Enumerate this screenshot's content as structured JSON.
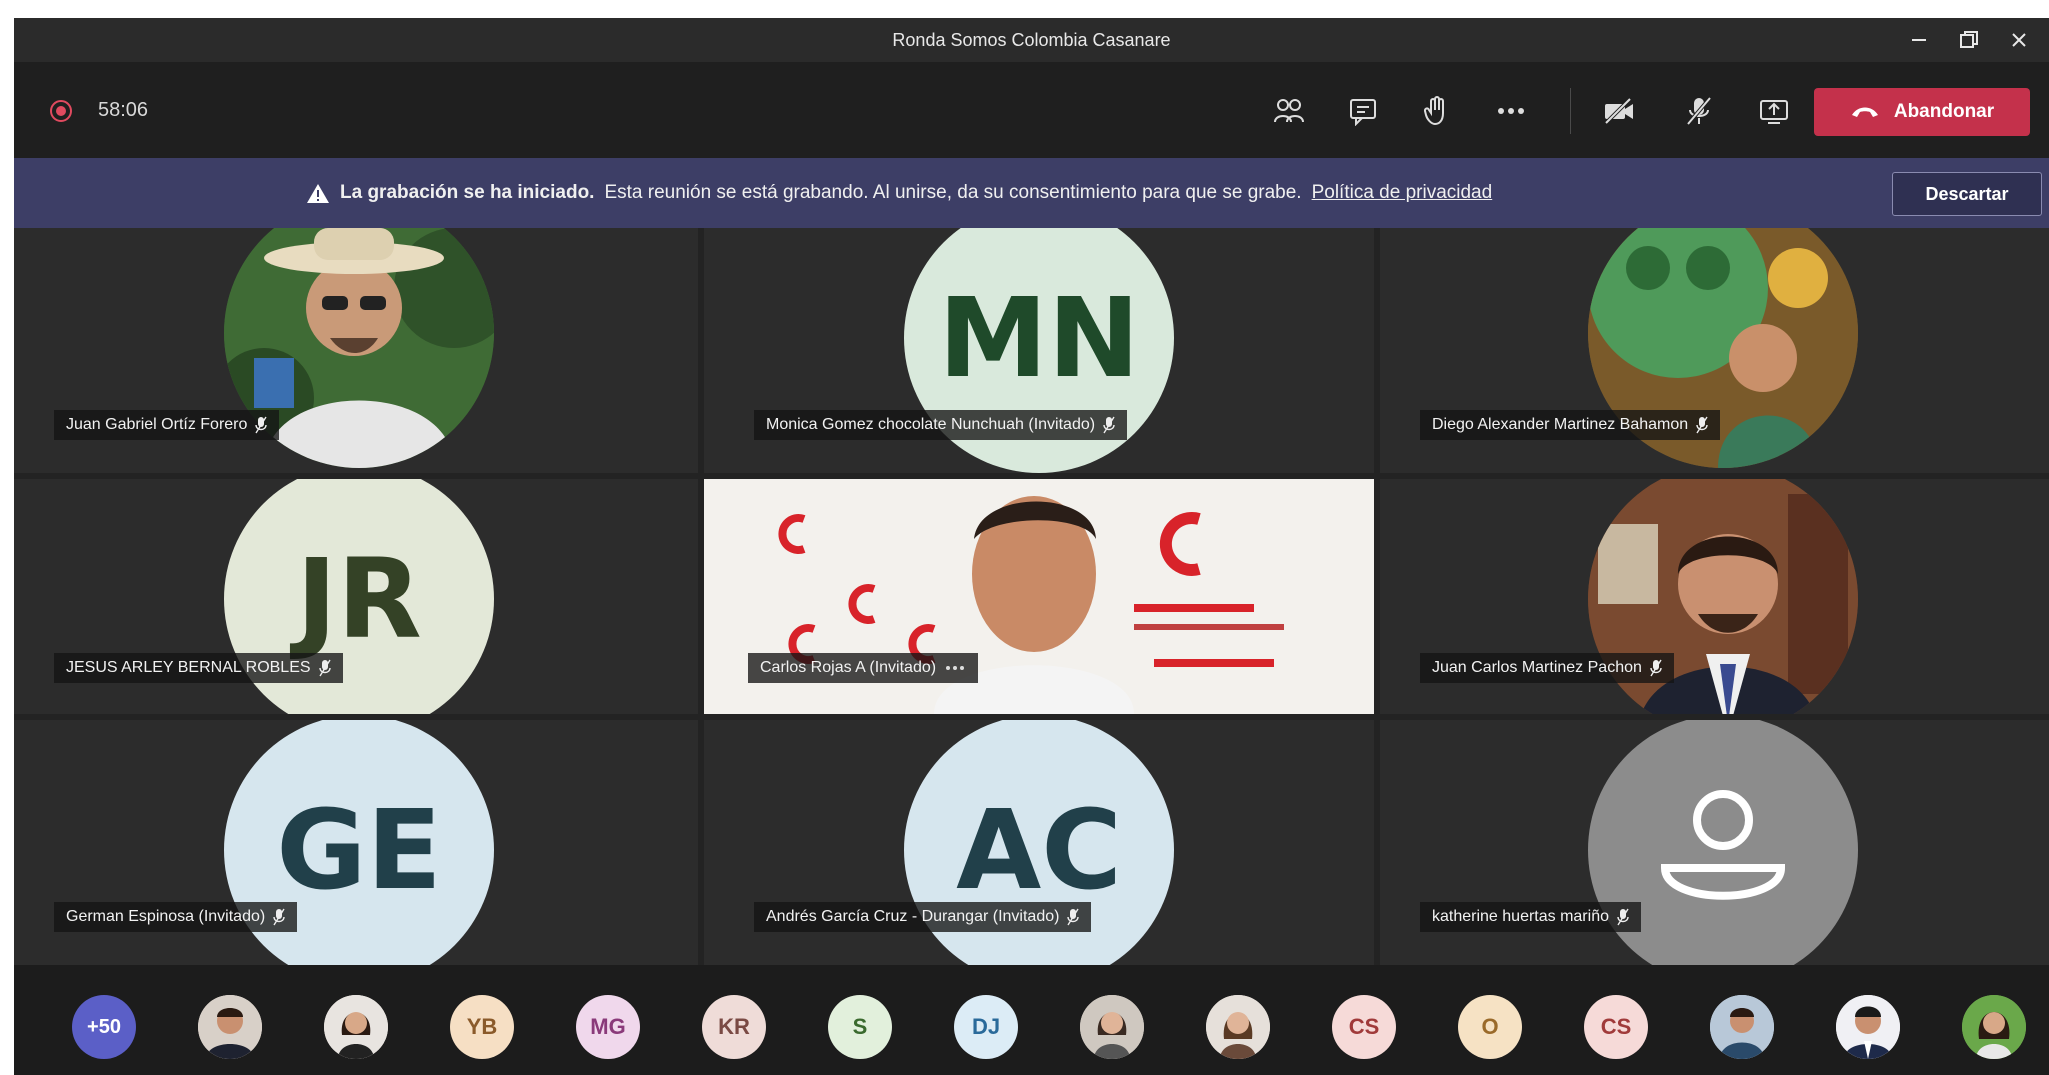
{
  "window": {
    "title": "Ronda Somos Colombia Casanare"
  },
  "toolbar": {
    "timer": "58:06",
    "leave_label": "Abandonar"
  },
  "banner": {
    "bold": "La grabación se ha iniciado.",
    "text": "Esta reunión se está grabando. Al unirse, da su consentimiento para que se grabe.",
    "link": "Política de privacidad",
    "dismiss": "Descartar"
  },
  "participants": [
    {
      "name": "Juan Gabriel Ortíz Forero",
      "initials": "",
      "kind": "photo"
    },
    {
      "name": "Monica Gomez chocolate Nunchuah (Invitado)",
      "initials": "MN",
      "kind": "initials"
    },
    {
      "name": "Diego Alexander Martinez Bahamon",
      "initials": "",
      "kind": "photo"
    },
    {
      "name": "JESUS ARLEY BERNAL ROBLES",
      "initials": "JR",
      "kind": "initials"
    },
    {
      "name": "Carlos Rojas A (Invitado)",
      "initials": "",
      "kind": "video"
    },
    {
      "name": "Juan Carlos Martinez Pachon",
      "initials": "",
      "kind": "photo"
    },
    {
      "name": "German Espinosa (Invitado)",
      "initials": "GE",
      "kind": "initials"
    },
    {
      "name": "Andrés García Cruz - Durangar (Invitado)",
      "initials": "AC",
      "kind": "initials"
    },
    {
      "name": "katherine huertas mariño",
      "initials": "",
      "kind": "placeholder"
    }
  ],
  "strip": {
    "overflow": "+50",
    "avatars": [
      "",
      "",
      "YB",
      "MG",
      "KR",
      "S",
      "DJ",
      "",
      "",
      "CS",
      "O",
      "CS",
      "",
      "",
      ""
    ]
  },
  "colors": {
    "leave": "#c4314b",
    "banner": "#3d3e66",
    "recording": "#e04a5f"
  }
}
